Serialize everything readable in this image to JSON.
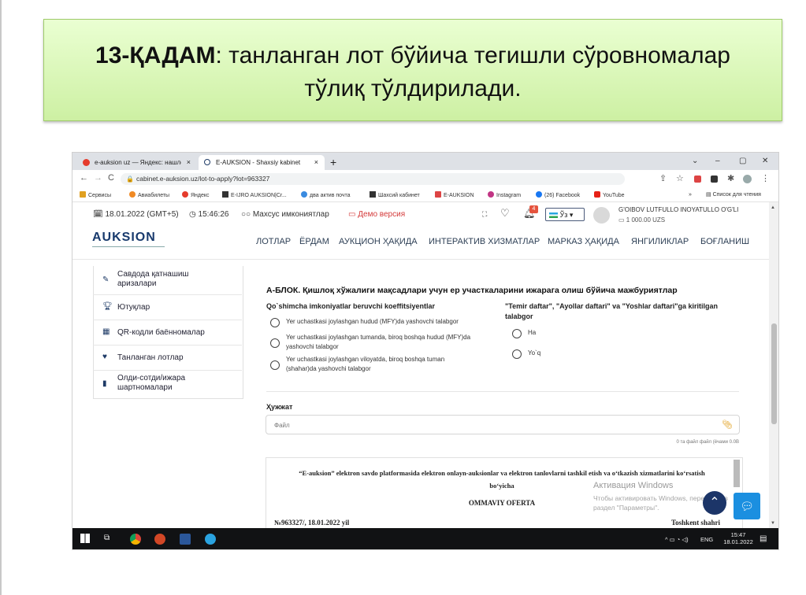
{
  "banner": {
    "step_bold": "13-ҚАДАМ",
    "text_line1": ": танланган лот бўйича тегишли сўровномалар",
    "text_line2": "тўлиқ тўлдирилади."
  },
  "browser": {
    "tabs": [
      {
        "label": "e-auksion uz — Яндекс: нашлось",
        "close": "×"
      },
      {
        "label": "E-AUKSION - Shaxsiy kabinet",
        "close": "×"
      }
    ],
    "new_tab": "+",
    "url": "cabinet.e-auksion.uz/lot-to-apply?lot=963327",
    "window_controls": [
      "⌄",
      "–",
      "▢",
      "✕"
    ],
    "bookmarks": [
      "Сервисы",
      "Авиабилеты",
      "Яндекс",
      "E-IJRO AUKSION|Cr...",
      "два актив почта",
      "Шахсий кабинет",
      "E-AUKSION",
      "Instagram",
      "(26) Facebook",
      "YouTube"
    ],
    "reading_list": "Список для чтения",
    "bookmarks_more": "»"
  },
  "site": {
    "date": "18.01.2022 (GMT+5)",
    "time": "15:46:26",
    "special": "Махсус имкониятлар",
    "demo": "Демо версия",
    "notif_count": "4",
    "lang": "Ўз",
    "user_name": "G'OIBOV LUTFULLO INOYATULLO O'G'LI",
    "balance": "1 000.00 UZS",
    "logo": "AUKSION",
    "menu": [
      "ЛОТЛАР",
      "ЁРДАМ",
      "АУКЦИОН ҲАҚИДА",
      "ИНТЕРАКТИВ ХИЗМАТЛАР",
      "МАРКАЗ ҲАҚИДА",
      "ЯНГИЛИКЛАР",
      "БОҒЛАНИШ"
    ]
  },
  "sidebar": {
    "items": [
      {
        "line1": "Савдода қатнашиш",
        "line2": "аризалари",
        "icon": "pen-icon"
      },
      {
        "line1": "Ютуқлар",
        "line2": "",
        "icon": "trophy-icon"
      },
      {
        "line1": "QR-кодли баённомалар",
        "line2": "",
        "icon": "qr-icon"
      },
      {
        "line1": "Танланган лотлар",
        "line2": "",
        "icon": "heart-icon"
      },
      {
        "line1": "Олди-сотди/ижара",
        "line2": "шартномалари",
        "icon": "document-icon"
      }
    ]
  },
  "main": {
    "block_title": "А-БЛОК. Қишлоқ хўжалиги мақсадлари учун ер участкаларини ижарага олиш бўйича мажбуриятлар",
    "left_heading": "Qo`shimcha imkoniyatlar beruvchi koeffitsiyentlar",
    "left_options": [
      {
        "line1": "Yer uchastkasi joylashgan hudud (MFY)da yashovchi talabgor",
        "line2": ""
      },
      {
        "line1": "Yer uchastkasi joylashgan tumanda, biroq boshqa hudud (MFY)da",
        "line2": "yashovchi talabgor"
      },
      {
        "line1": "Yer uchastkasi joylashgan viloyatda, biroq boshqa tuman",
        "line2": "(shahar)da yashovchi talabgor"
      }
    ],
    "right_heading_line1": "\"Temir daftar\", \"Ayollar daftari\" va \"Yoshlar daftari\"ga kiritilgan",
    "right_heading_line2": "talabgor",
    "right_options": [
      "Ha",
      "Yo`q"
    ],
    "doc_label": "Ҳужжат",
    "file_placeholder": "Файл",
    "file_note": "0 та файл файл (ёчами 0.0В"
  },
  "offer": {
    "title_line1": "“E-auksion” elektron savdo platformasida elektron onlayn-auksionlar va elektron tanlovlarni tashkil etish va oʻtkazish xizmatlarini koʻrsatish",
    "title_line2": "boʻyicha",
    "heading": "OMMAVIY OFERTA",
    "number": "№963327/, 18.01.2022 yil",
    "city": "Toshkent shahri"
  },
  "watermark": {
    "title": "Активация Windows",
    "line1": "Чтобы активировать Windows, перейдите в",
    "line2": "раздел \"Параметры\"."
  },
  "taskbar": {
    "lang": "ENG",
    "time": "15:47",
    "date": "18.01.2022",
    "tray": "^ ▭ ◔ ◁)"
  }
}
